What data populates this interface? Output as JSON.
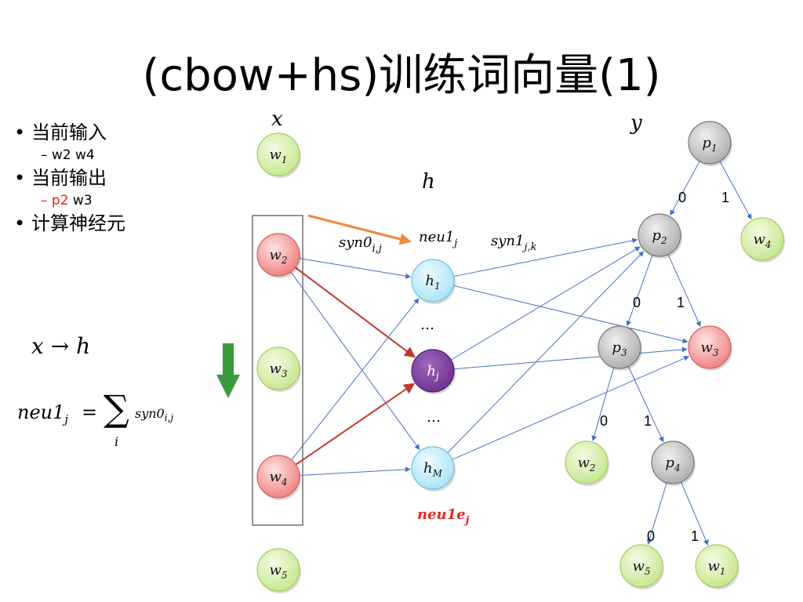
{
  "slide": {
    "title": "(cbow+hs)训练词向量(1)",
    "bullets": [
      {
        "text": "当前输入",
        "sub": [
          {
            "parts": [
              {
                "t": "– w2 w4",
                "red": false
              }
            ]
          }
        ]
      },
      {
        "text": "当前输出",
        "sub": [
          {
            "parts": [
              {
                "t": "– p2",
                "red": true
              },
              {
                "t": " w3",
                "red": false
              }
            ]
          }
        ]
      },
      {
        "text": "计算神经元",
        "sub": []
      }
    ],
    "formula1": {
      "lhs": "x",
      "arrow": "→",
      "rhs": "h"
    },
    "formula2": {
      "lhs": "neu1",
      "lhs_sub": "j",
      "eq": "=",
      "sum": "∑",
      "sum_sub": "i",
      "term": "syn0",
      "term_sub": "i,j"
    }
  },
  "diagram": {
    "col_labels": {
      "x": "x",
      "h": "h",
      "y": "y"
    },
    "edge_labels": {
      "syn0": {
        "main": "syn0",
        "sub": "i,j"
      },
      "neu1": {
        "main": "neu1",
        "sub": "j"
      },
      "syn1": {
        "main": "syn1",
        "sub": "j,k"
      },
      "neu1e": {
        "main": "neu1e",
        "sub": "j"
      }
    },
    "input_nodes": [
      {
        "id": "w1",
        "main": "w",
        "sub": "1",
        "state": "inactive"
      },
      {
        "id": "w2",
        "main": "w",
        "sub": "2",
        "state": "active"
      },
      {
        "id": "w3",
        "main": "w",
        "sub": "3",
        "state": "inactive"
      },
      {
        "id": "w4",
        "main": "w",
        "sub": "4",
        "state": "active"
      },
      {
        "id": "w5",
        "main": "w",
        "sub": "5",
        "state": "inactive"
      }
    ],
    "hidden_nodes": [
      {
        "id": "h1",
        "main": "h",
        "sub": "1",
        "state": "normal"
      },
      {
        "id": "hj",
        "main": "h",
        "sub": "j",
        "state": "current"
      },
      {
        "id": "hM",
        "main": "h",
        "sub": "M",
        "state": "normal"
      }
    ],
    "ellipsis": "…",
    "tree_nodes": [
      {
        "id": "p1",
        "main": "p",
        "sub": "1",
        "kind": "inner"
      },
      {
        "id": "p2",
        "main": "p",
        "sub": "2",
        "kind": "inner"
      },
      {
        "id": "w4t",
        "main": "w",
        "sub": "4",
        "kind": "leaf"
      },
      {
        "id": "p3",
        "main": "p",
        "sub": "3",
        "kind": "inner"
      },
      {
        "id": "w3t",
        "main": "w",
        "sub": "3",
        "kind": "target"
      },
      {
        "id": "w2t",
        "main": "w",
        "sub": "2",
        "kind": "leaf"
      },
      {
        "id": "p4",
        "main": "p",
        "sub": "4",
        "kind": "inner"
      },
      {
        "id": "w5t",
        "main": "w",
        "sub": "5",
        "kind": "leaf"
      },
      {
        "id": "w1t",
        "main": "w",
        "sub": "1",
        "kind": "leaf"
      }
    ],
    "branch_bits": [
      {
        "parent": "p1",
        "zero": "0",
        "one": "1"
      },
      {
        "parent": "p2",
        "zero": "0",
        "one": "1"
      },
      {
        "parent": "p3",
        "zero": "0",
        "one": "1"
      },
      {
        "parent": "p4",
        "zero": "0",
        "one": "1"
      }
    ],
    "colors": {
      "input_active": "#ef7d7d",
      "input_inactive": "#c4e68a",
      "hidden": "#a6e3f5",
      "hidden_current": "#7a3d9a",
      "tree_inner": "#b5b5b5",
      "edge": "#4472c4",
      "edge_highlight": "#c0392b",
      "arrow_orange": "#f0883a",
      "arrow_green": "#3a9a3a",
      "neu1e": "#e8261c"
    }
  }
}
